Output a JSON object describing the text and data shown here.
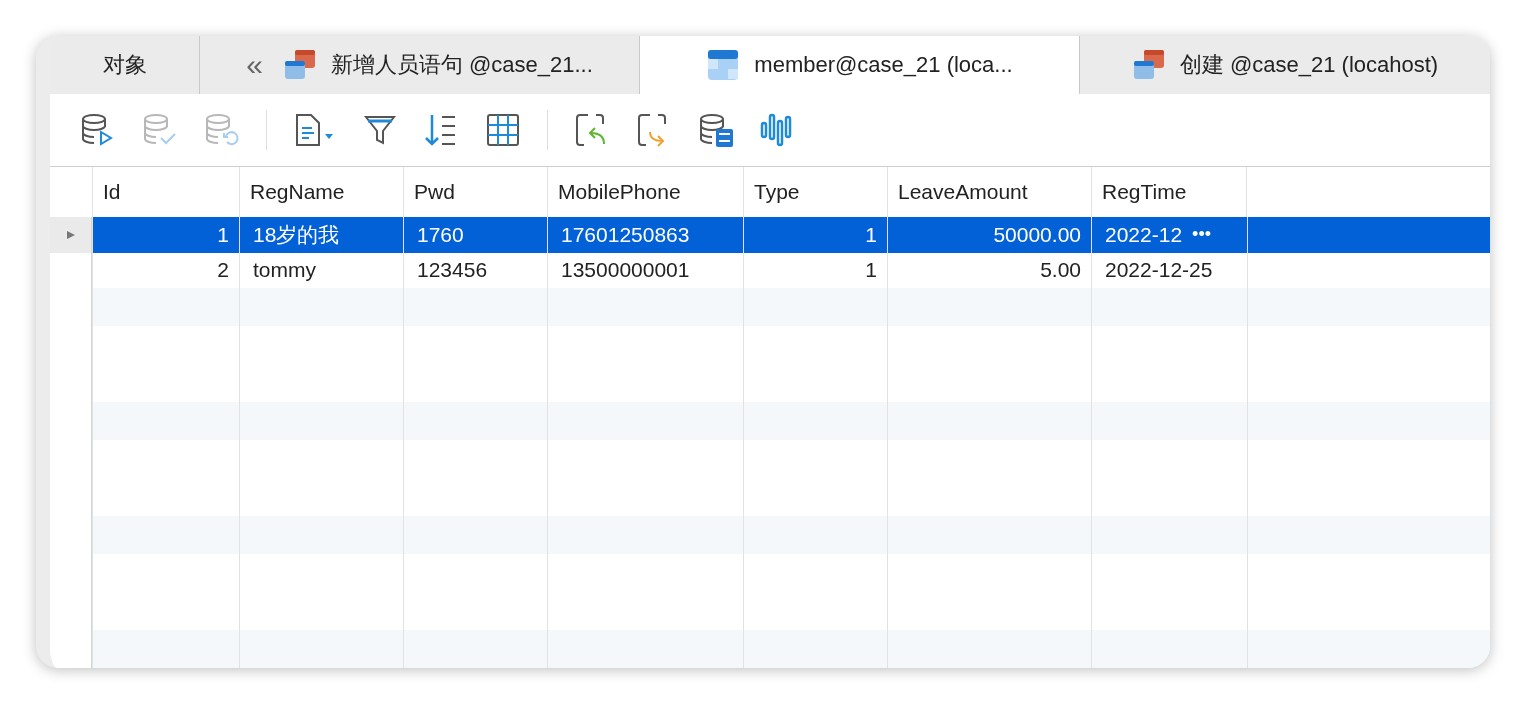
{
  "tabs": [
    {
      "label": "对象",
      "selected": false,
      "kind": "objects"
    },
    {
      "label": "新增人员语句 @case_21...",
      "selected": false,
      "kind": "query",
      "chevron": "«"
    },
    {
      "label": "member@case_21 (loca...",
      "selected": true,
      "kind": "table"
    },
    {
      "label": "创建 @case_21 (locahost)",
      "selected": false,
      "kind": "query"
    }
  ],
  "toolbar": [
    {
      "kind": "db-run",
      "disabled": false
    },
    {
      "kind": "db-check",
      "disabled": true
    },
    {
      "kind": "db-undo",
      "disabled": true
    },
    {
      "kind": "separator"
    },
    {
      "kind": "document",
      "disabled": false
    },
    {
      "kind": "filter",
      "disabled": false
    },
    {
      "kind": "sort",
      "disabled": false
    },
    {
      "kind": "grid",
      "disabled": false
    },
    {
      "kind": "separator"
    },
    {
      "kind": "back",
      "disabled": false
    },
    {
      "kind": "forward",
      "disabled": false
    },
    {
      "kind": "db-binary",
      "disabled": false
    },
    {
      "kind": "waveform",
      "disabled": false
    }
  ],
  "table": {
    "columns": [
      "Id",
      "RegName",
      "Pwd",
      "MobilePhone",
      "Type",
      "LeaveAmount",
      "RegTime"
    ],
    "rows": [
      {
        "selected": true,
        "cells": [
          "1",
          "18岁的我",
          "1760",
          "17601250863",
          "1",
          "50000.00",
          "2022-12"
        ],
        "more": "•••"
      },
      {
        "selected": false,
        "cells": [
          "2",
          "tommy",
          "123456",
          " 13500000001",
          "1",
          "5.00",
          "2022-12-25"
        ]
      }
    ]
  }
}
